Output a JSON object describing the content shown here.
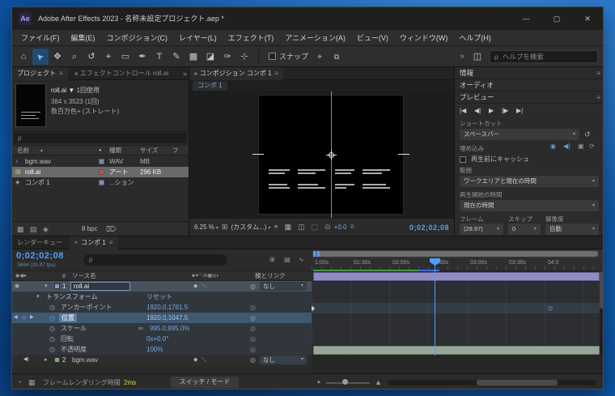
{
  "titlebar": {
    "logo": "Ae",
    "title": "Adobe After Effects 2023 - 名称未設定プロジェクト.aep *",
    "minimize": "—",
    "maximize": "▢",
    "close": "✕"
  },
  "menubar": {
    "items": [
      "ファイル(F)",
      "編集(E)",
      "コンポジション(C)",
      "レイヤー(L)",
      "エフェクト(T)",
      "アニメーション(A)",
      "ビュー(V)",
      "ウィンドウ(W)",
      "ヘルプ(H)"
    ]
  },
  "toolbar": {
    "tools": [
      "⌂",
      "➤",
      "✥",
      "⌕",
      "↺",
      "⌖",
      "▭",
      "✒",
      "T",
      "✎",
      "▩",
      "◪",
      "✑",
      "⊹"
    ],
    "snap_label": "スナップ",
    "snap_icons": [
      "⌖",
      "⧉"
    ],
    "overflow": "»",
    "workspace_icon": "◫",
    "search_icon": "ρ",
    "search_placeholder": "ヘルプを検索"
  },
  "project": {
    "tab_active": "プロジェクト",
    "tab_inactive": "エフェクトコントロール roll.ai",
    "overflow": "»",
    "menu_icon": "≡",
    "preview": {
      "title": "roll.ai ▼",
      "usage": "1回使用",
      "line2": "384 x 3523 (1回)",
      "line3": "数百万色+ (ストレート)"
    },
    "search_icon": "ρ",
    "columns": {
      "name": "名前",
      "sort": "▲",
      "swatch": "●",
      "type": "種類",
      "size": "サイズ",
      "extra": "フ"
    },
    "items": [
      {
        "icon": "♪",
        "name": "bgm.wav",
        "type": "WAV",
        "size": "MB",
        "swatch": "#7d8aa6"
      },
      {
        "icon": "▤",
        "name": "roll.ai",
        "type": "アート",
        "size": "296 KB",
        "swatch": "#c24e4e"
      },
      {
        "icon": "◈",
        "name": "コンポ 1",
        "type": "...ション",
        "size": "",
        "swatch": "#8d86c9"
      }
    ],
    "footer": {
      "icons": [
        "▦",
        "▤",
        "◈"
      ],
      "bpc": "8 bpc",
      "trash": "⌦"
    }
  },
  "comp": {
    "tab_icon": "■",
    "tab": "コンポジション コンポ 1",
    "menu_icon": "≡",
    "viewer_tab": "コンポ 1",
    "toolbar": {
      "zoom": "6.25 %",
      "grid_icon": "⊞",
      "resolution": "(カスタム...)",
      "icons": [
        "⌖",
        "▦",
        "◫",
        "⬚"
      ],
      "exposure_icon": "⊙",
      "exposure": "+0.0",
      "snapshot_icon": "⌾",
      "timecode": "0;02;02;08"
    }
  },
  "rightpanel": {
    "info_title": "情報",
    "audio_title": "オーディオ",
    "preview_title": "プレビュー",
    "menu_icon": "≡",
    "transport": [
      "|◀",
      "◀|",
      "▶",
      "|▶",
      "▶|"
    ],
    "shortcut_label": "ショートカット",
    "shortcut_value": "スペースバー",
    "reset_icon": "↺",
    "include_label": "埋め込み",
    "include_icons": [
      "◉",
      "◀)",
      "▣",
      "⟳"
    ],
    "cache_label": "再生前にキャッシュ",
    "range_label": "範囲",
    "range_value": "ワークエリアと現在の時間",
    "playfrom_label": "再生開始の時間",
    "playfrom_value": "現在の時間",
    "fps_label": "フレーム",
    "skip_label": "スキップ",
    "res_label": "解像度",
    "fps_value": "(29.97)",
    "skip_value": "0",
    "res_value": "自動",
    "dropdown": "▾"
  },
  "timeline": {
    "tab_renderqueue": "レンダーキュー",
    "tab_close": "×",
    "tab_comp": "コンポ 1",
    "menu_icon": "≡",
    "timecode": "0;02;02;08",
    "frame_info": "3664 (29.97 fps)",
    "search_icon": "ρ",
    "header_icons": [
      "⊞",
      "▤",
      "∿"
    ],
    "columns": {
      "av": "◉◀●",
      "num": "#",
      "source": "ソース名",
      "switches": "♣✦＼fx▦◎◐",
      "parent": "親とリンク"
    },
    "layer1": {
      "eye": "◉",
      "twirl": "▾",
      "num": "1",
      "name": "roll.ai",
      "switches": "◆＼",
      "parent": "なし"
    },
    "transform": {
      "twirl": "▾",
      "label": "トランスフォーム",
      "reset": "リセット"
    },
    "props": [
      {
        "label": "アンカーポイント",
        "value": "1920.0,1761.5"
      },
      {
        "label": "位置",
        "value": "1920.0,1047.5"
      },
      {
        "label": "スケール",
        "value": "995.0,995.0%"
      },
      {
        "label": "回転",
        "value": "0x+0.0°"
      },
      {
        "label": "不透明度",
        "value": "100%"
      }
    ],
    "scale_link": "∞",
    "kf_nav": {
      "prev": "◀",
      "dot": "◇",
      "next": "▶"
    },
    "stopwatch": "◷",
    "pickwhip": "◎",
    "dropdown": "▾",
    "layer2": {
      "audio": "◀)",
      "twirl": "▸",
      "num": "2",
      "name": "bgm.wav",
      "switches": "◆＼",
      "parent": "なし"
    },
    "ruler": [
      "1:00s",
      "01:30s",
      "02:00s",
      "02:30s",
      "03:00s",
      "03:30s",
      "04:0"
    ],
    "keyframes": {
      "solid": "◆",
      "hollow": "◇"
    },
    "footer": {
      "icons": [
        "◔",
        "▦"
      ],
      "render_label": "フレームレンダリング時間",
      "render_value": "2ms",
      "switches_label": "スイッチ / モード",
      "zoom_small": "▲",
      "zoom_large": "▲"
    }
  },
  "colors": {
    "accent_blue": "#4da0ff",
    "layer_bar": "#8f8cc0",
    "audio_bar": "#97a797",
    "cache_green": "#3f9d3f",
    "render_time_yellow": "#e8d44d"
  }
}
